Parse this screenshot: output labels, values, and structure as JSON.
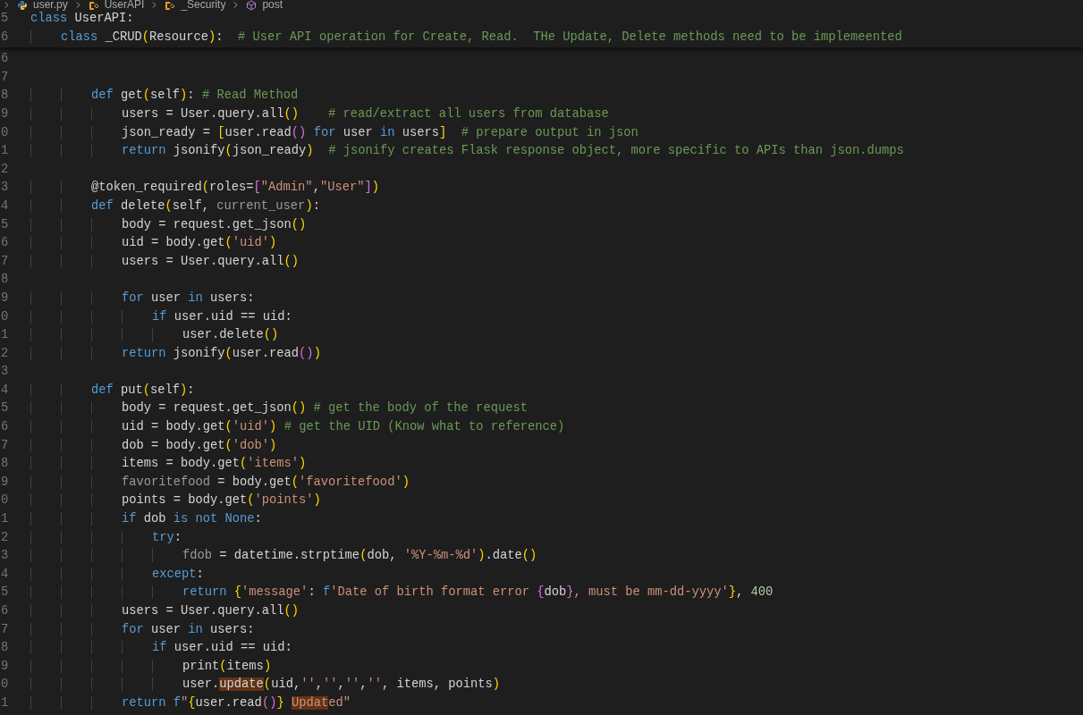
{
  "breadcrumb": [
    {
      "kind": "file",
      "label": "user.py"
    },
    {
      "kind": "class",
      "label": "UserAPI"
    },
    {
      "kind": "class",
      "label": "_Security"
    },
    {
      "kind": "method",
      "label": "post"
    }
  ],
  "sticky_lines": [
    {
      "number": "5",
      "tokens": [
        {
          "kind": "keyword",
          "text": "class"
        },
        {
          "kind": "plain",
          "text": " UserAPI:"
        }
      ]
    },
    {
      "number": "6",
      "tokens": [
        {
          "kind": "keyword",
          "text": "    class"
        },
        {
          "kind": "plain",
          "text": " _CRUD"
        },
        {
          "kind": "bracket1",
          "text": "("
        },
        {
          "kind": "plain",
          "text": "Resource"
        },
        {
          "kind": "bracket1",
          "text": ")"
        },
        {
          "kind": "plain",
          "text": ":"
        },
        {
          "kind": "comment",
          "text": "  # User API operation for Create, Read.  THe Update, Delete methods need to be implemeented"
        }
      ]
    }
  ],
  "lines": [
    {
      "number": "6"
    },
    {
      "number": "7"
    },
    {
      "number": "8",
      "tokens": [
        {
          "kind": "keyword",
          "text": "        def"
        },
        {
          "kind": "plain",
          "text": " get"
        },
        {
          "kind": "bracket1",
          "text": "("
        },
        {
          "kind": "plain",
          "text": "self"
        },
        {
          "kind": "bracket1",
          "text": ")"
        },
        {
          "kind": "plain",
          "text": ":"
        },
        {
          "kind": "comment",
          "text": " # Read Method"
        }
      ]
    },
    {
      "number": "9",
      "tokens": [
        {
          "kind": "plain",
          "text": "            users = User.query.all"
        },
        {
          "kind": "bracket1",
          "text": "()"
        },
        {
          "kind": "comment",
          "text": "    # read/extract all users from database"
        }
      ]
    },
    {
      "number": "0",
      "tokens": [
        {
          "kind": "plain",
          "text": "            json_ready = "
        },
        {
          "kind": "bracket1",
          "text": "["
        },
        {
          "kind": "plain",
          "text": "user.read"
        },
        {
          "kind": "bracket2",
          "text": "()"
        },
        {
          "kind": "keyword",
          "text": " for"
        },
        {
          "kind": "plain",
          "text": " user "
        },
        {
          "kind": "keyword",
          "text": "in"
        },
        {
          "kind": "plain",
          "text": " users"
        },
        {
          "kind": "bracket1",
          "text": "]"
        },
        {
          "kind": "comment",
          "text": "  # prepare output in json"
        }
      ]
    },
    {
      "number": "1",
      "tokens": [
        {
          "kind": "keyword",
          "text": "            return"
        },
        {
          "kind": "plain",
          "text": " jsonify"
        },
        {
          "kind": "bracket1",
          "text": "("
        },
        {
          "kind": "plain",
          "text": "json_ready"
        },
        {
          "kind": "bracket1",
          "text": ")"
        },
        {
          "kind": "comment",
          "text": "  # jsonify creates Flask response object, more specific to APIs than json.dumps"
        }
      ]
    },
    {
      "number": "2"
    },
    {
      "number": "3",
      "tokens": [
        {
          "kind": "plain",
          "text": "        @token_required"
        },
        {
          "kind": "bracket1",
          "text": "("
        },
        {
          "kind": "plain",
          "text": "roles="
        },
        {
          "kind": "bracket2",
          "text": "["
        },
        {
          "kind": "string",
          "text": "\"Admin\""
        },
        {
          "kind": "plain",
          "text": ","
        },
        {
          "kind": "string",
          "text": "\"User\""
        },
        {
          "kind": "bracket2",
          "text": "]"
        },
        {
          "kind": "bracket1",
          "text": ")"
        }
      ]
    },
    {
      "number": "4",
      "tokens": [
        {
          "kind": "keyword",
          "text": "        def"
        },
        {
          "kind": "plain",
          "text": " delete"
        },
        {
          "kind": "bracket1",
          "text": "("
        },
        {
          "kind": "plain",
          "text": "self, "
        },
        {
          "kind": "dim",
          "text": "current_user"
        },
        {
          "kind": "bracket1",
          "text": ")"
        },
        {
          "kind": "plain",
          "text": ":"
        }
      ]
    },
    {
      "number": "5",
      "tokens": [
        {
          "kind": "plain",
          "text": "            body = request.get_json"
        },
        {
          "kind": "bracket1",
          "text": "()"
        }
      ]
    },
    {
      "number": "6",
      "tokens": [
        {
          "kind": "plain",
          "text": "            uid = body.get"
        },
        {
          "kind": "bracket1",
          "text": "("
        },
        {
          "kind": "string",
          "text": "'uid'"
        },
        {
          "kind": "bracket1",
          "text": ")"
        }
      ]
    },
    {
      "number": "7",
      "tokens": [
        {
          "kind": "plain",
          "text": "            users = User.query.all"
        },
        {
          "kind": "bracket1",
          "text": "()"
        }
      ]
    },
    {
      "number": "8"
    },
    {
      "number": "9",
      "tokens": [
        {
          "kind": "keyword",
          "text": "            for"
        },
        {
          "kind": "plain",
          "text": " user "
        },
        {
          "kind": "keyword",
          "text": "in"
        },
        {
          "kind": "plain",
          "text": " users:"
        }
      ]
    },
    {
      "number": "0",
      "tokens": [
        {
          "kind": "keyword",
          "text": "                if"
        },
        {
          "kind": "plain",
          "text": " user.uid == uid:"
        }
      ]
    },
    {
      "number": "1",
      "tokens": [
        {
          "kind": "plain",
          "text": "                    user.delete"
        },
        {
          "kind": "bracket1",
          "text": "()"
        }
      ]
    },
    {
      "number": "2",
      "tokens": [
        {
          "kind": "keyword",
          "text": "            return"
        },
        {
          "kind": "plain",
          "text": " jsonify"
        },
        {
          "kind": "bracket1",
          "text": "("
        },
        {
          "kind": "plain",
          "text": "user.read"
        },
        {
          "kind": "bracket2",
          "text": "()"
        },
        {
          "kind": "bracket1",
          "text": ")"
        }
      ]
    },
    {
      "number": "3"
    },
    {
      "number": "4",
      "tokens": [
        {
          "kind": "keyword",
          "text": "        def"
        },
        {
          "kind": "plain",
          "text": " put"
        },
        {
          "kind": "bracket1",
          "text": "("
        },
        {
          "kind": "plain",
          "text": "self"
        },
        {
          "kind": "bracket1",
          "text": ")"
        },
        {
          "kind": "plain",
          "text": ":"
        }
      ]
    },
    {
      "number": "5",
      "tokens": [
        {
          "kind": "plain",
          "text": "            body = request.get_json"
        },
        {
          "kind": "bracket1",
          "text": "()"
        },
        {
          "kind": "comment",
          "text": " # get the body of the request"
        }
      ]
    },
    {
      "number": "6",
      "tokens": [
        {
          "kind": "plain",
          "text": "            uid = body.get"
        },
        {
          "kind": "bracket1",
          "text": "("
        },
        {
          "kind": "string",
          "text": "'uid'"
        },
        {
          "kind": "bracket1",
          "text": ")"
        },
        {
          "kind": "comment",
          "text": " # get the UID (Know what to reference)"
        }
      ]
    },
    {
      "number": "7",
      "tokens": [
        {
          "kind": "plain",
          "text": "            dob = body.get"
        },
        {
          "kind": "bracket1",
          "text": "("
        },
        {
          "kind": "string",
          "text": "'dob'"
        },
        {
          "kind": "bracket1",
          "text": ")"
        }
      ]
    },
    {
      "number": "8",
      "tokens": [
        {
          "kind": "plain",
          "text": "            items = body.get"
        },
        {
          "kind": "bracket1",
          "text": "("
        },
        {
          "kind": "string",
          "text": "'items'"
        },
        {
          "kind": "bracket1",
          "text": ")"
        }
      ]
    },
    {
      "number": "9",
      "tokens": [
        {
          "kind": "dim",
          "text": "            favoritefood"
        },
        {
          "kind": "plain",
          "text": " = body.get"
        },
        {
          "kind": "bracket1",
          "text": "("
        },
        {
          "kind": "string",
          "text": "'favoritefood'"
        },
        {
          "kind": "bracket1",
          "text": ")"
        }
      ]
    },
    {
      "number": "0",
      "tokens": [
        {
          "kind": "plain",
          "text": "            points = body.get"
        },
        {
          "kind": "bracket1",
          "text": "("
        },
        {
          "kind": "string",
          "text": "'points'"
        },
        {
          "kind": "bracket1",
          "text": ")"
        }
      ]
    },
    {
      "number": "1",
      "tokens": [
        {
          "kind": "keyword",
          "text": "            if"
        },
        {
          "kind": "plain",
          "text": " dob "
        },
        {
          "kind": "keyword",
          "text": "is not None"
        },
        {
          "kind": "plain",
          "text": ":"
        }
      ]
    },
    {
      "number": "2",
      "tokens": [
        {
          "kind": "keyword",
          "text": "                try"
        },
        {
          "kind": "plain",
          "text": ":"
        }
      ]
    },
    {
      "number": "3",
      "tokens": [
        {
          "kind": "dim",
          "text": "                    fdob"
        },
        {
          "kind": "plain",
          "text": " = datetime.strptime"
        },
        {
          "kind": "bracket1",
          "text": "("
        },
        {
          "kind": "plain",
          "text": "dob, "
        },
        {
          "kind": "string",
          "text": "'%Y-%m-%d'"
        },
        {
          "kind": "bracket1",
          "text": ")"
        },
        {
          "kind": "plain",
          "text": ".date"
        },
        {
          "kind": "bracket1",
          "text": "()"
        }
      ]
    },
    {
      "number": "4",
      "tokens": [
        {
          "kind": "keyword",
          "text": "                except"
        },
        {
          "kind": "plain",
          "text": ":"
        }
      ]
    },
    {
      "number": "5",
      "tokens": [
        {
          "kind": "keyword",
          "text": "                    return"
        },
        {
          "kind": "bracket1",
          "text": " {"
        },
        {
          "kind": "string",
          "text": "'message'"
        },
        {
          "kind": "plain",
          "text": ": "
        },
        {
          "kind": "keyword",
          "text": "f"
        },
        {
          "kind": "string",
          "text": "'Date of birth format error "
        },
        {
          "kind": "bracket2",
          "text": "{"
        },
        {
          "kind": "plain",
          "text": "dob"
        },
        {
          "kind": "bracket2",
          "text": "}"
        },
        {
          "kind": "string",
          "text": ", must be mm-dd-yyyy'"
        },
        {
          "kind": "bracket1",
          "text": "}"
        },
        {
          "kind": "plain",
          "text": ", "
        },
        {
          "kind": "number",
          "text": "400"
        }
      ]
    },
    {
      "number": "6",
      "tokens": [
        {
          "kind": "plain",
          "text": "            users = User.query.all"
        },
        {
          "kind": "bracket1",
          "text": "()"
        }
      ]
    },
    {
      "number": "7",
      "tokens": [
        {
          "kind": "keyword",
          "text": "            for"
        },
        {
          "kind": "plain",
          "text": " user "
        },
        {
          "kind": "keyword",
          "text": "in"
        },
        {
          "kind": "plain",
          "text": " users:"
        }
      ]
    },
    {
      "number": "8",
      "tokens": [
        {
          "kind": "keyword",
          "text": "                if"
        },
        {
          "kind": "plain",
          "text": " user.uid == uid:"
        }
      ]
    },
    {
      "number": "9",
      "tokens": [
        {
          "kind": "plain",
          "text": "                    print"
        },
        {
          "kind": "bracket1",
          "text": "("
        },
        {
          "kind": "plain",
          "text": "items"
        },
        {
          "kind": "bracket1",
          "text": ")"
        }
      ]
    },
    {
      "number": "0",
      "tokens": [
        {
          "kind": "plain",
          "text": "                    user."
        },
        {
          "kind": "match",
          "text": "update"
        },
        {
          "kind": "bracket1",
          "text": "("
        },
        {
          "kind": "plain",
          "text": "uid,"
        },
        {
          "kind": "string",
          "text": "''"
        },
        {
          "kind": "plain",
          "text": ","
        },
        {
          "kind": "string",
          "text": "''"
        },
        {
          "kind": "plain",
          "text": ","
        },
        {
          "kind": "string",
          "text": "''"
        },
        {
          "kind": "plain",
          "text": ","
        },
        {
          "kind": "string",
          "text": "''"
        },
        {
          "kind": "plain",
          "text": ", items, points"
        },
        {
          "kind": "bracket1",
          "text": ")"
        }
      ]
    },
    {
      "number": "1",
      "tokens": [
        {
          "kind": "keyword",
          "text": "            return"
        },
        {
          "kind": "keyword",
          "text": " f"
        },
        {
          "kind": "string",
          "text": "\""
        },
        {
          "kind": "bracket1",
          "text": "{"
        },
        {
          "kind": "plain",
          "text": "user.read"
        },
        {
          "kind": "bracket2",
          "text": "()"
        },
        {
          "kind": "bracket1",
          "text": "} "
        },
        {
          "kind": "string-match",
          "text": "Updat"
        },
        {
          "kind": "string",
          "text": "ed\""
        }
      ]
    }
  ]
}
